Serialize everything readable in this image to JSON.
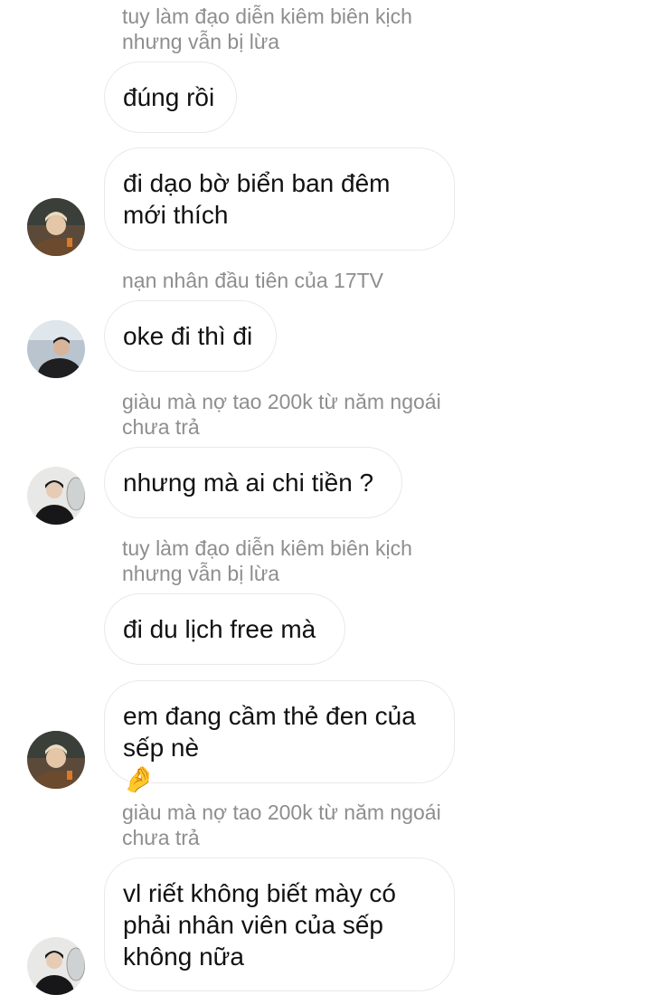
{
  "messages": [
    {
      "sender": "tuy làm đạo diễn kiêm biên kịch\nnhưng vẫn bị lừa"
    },
    {
      "text": "đúng rồi"
    },
    {
      "text": "đi dạo bờ biển ban đêm\nmới thích",
      "avatar": "avatar-blonde-man"
    },
    {
      "sender": "nạn nhân đầu tiên của 17TV"
    },
    {
      "text": "oke đi thì đi",
      "avatar": "avatar-dark-jacket-man"
    },
    {
      "sender": "giàu mà nợ tao 200k từ năm ngoái\nchưa trả"
    },
    {
      "text": "nhưng mà ai chi tiền ?",
      "avatar": "avatar-black-outfit-man"
    },
    {
      "sender": "tuy làm đạo diễn kiêm biên kịch\nnhưng vẫn bị lừa"
    },
    {
      "text": "đi du lịch free mà"
    },
    {
      "text": "em đang cầm thẻ đen của\nsếp nè",
      "emoji": "🤌",
      "avatar": "avatar-blonde-man"
    },
    {
      "sender": "giàu mà nợ tao 200k từ năm ngoái\nchưa trả"
    },
    {
      "text": "vl riết không biết mày có\nphải nhân viên của sếp\nkhông nữa",
      "avatar": "avatar-black-outfit-man"
    }
  ]
}
